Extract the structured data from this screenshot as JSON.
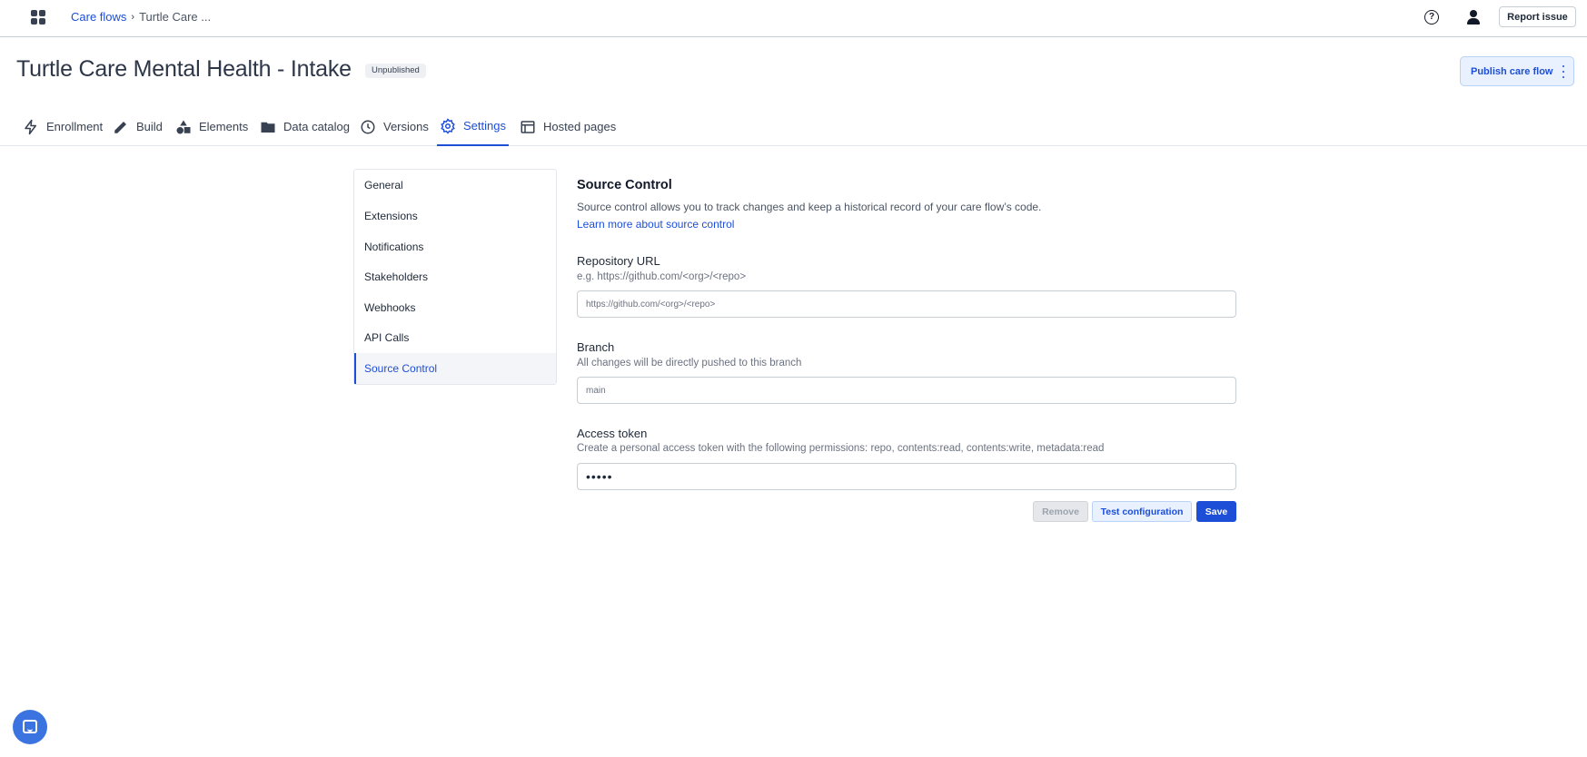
{
  "header": {
    "breadcrumb": {
      "root": "Care flows",
      "separator": "›",
      "current": "Turtle Care ..."
    },
    "report_issue": "Report issue",
    "help_icon_glyph": "?"
  },
  "page": {
    "title": "Turtle Care Mental Health - Intake",
    "status": "Unpublished",
    "publish_label": "Publish care flow"
  },
  "tabs": [
    {
      "label": "Enrollment",
      "icon": "lightning-icon"
    },
    {
      "label": "Build",
      "icon": "pencil-icon"
    },
    {
      "label": "Elements",
      "icon": "shapes-icon"
    },
    {
      "label": "Data catalog",
      "icon": "folder-icon"
    },
    {
      "label": "Versions",
      "icon": "clock-icon"
    },
    {
      "label": "Settings",
      "icon": "gear-icon",
      "active": true
    },
    {
      "label": "Hosted pages",
      "icon": "browser-window-icon"
    }
  ],
  "settings_nav": [
    {
      "label": "General"
    },
    {
      "label": "Extensions"
    },
    {
      "label": "Notifications"
    },
    {
      "label": "Stakeholders"
    },
    {
      "label": "Webhooks"
    },
    {
      "label": "API Calls"
    },
    {
      "label": "Source Control",
      "active": true
    }
  ],
  "source_control": {
    "title": "Source Control",
    "description": "Source control allows you to track changes and keep a historical record of your care flow’s code.",
    "learn_more": "Learn more about source control",
    "repo": {
      "label": "Repository URL",
      "help": "e.g. https://github.com/<org>/<repo>",
      "placeholder": "https://github.com/<org>/<repo>",
      "value": ""
    },
    "branch": {
      "label": "Branch",
      "help": "All changes will be directly pushed to this branch",
      "placeholder": "main",
      "value": ""
    },
    "token": {
      "label": "Access token",
      "help": "Create a personal access token with the following permissions: repo, contents:read, contents:write, metadata:read",
      "value": "•••••"
    },
    "buttons": {
      "remove": "Remove",
      "test": "Test configuration",
      "save": "Save"
    }
  },
  "colors": {
    "accent": "#1d4ed8",
    "chat_bubble": "#3b74e0"
  }
}
